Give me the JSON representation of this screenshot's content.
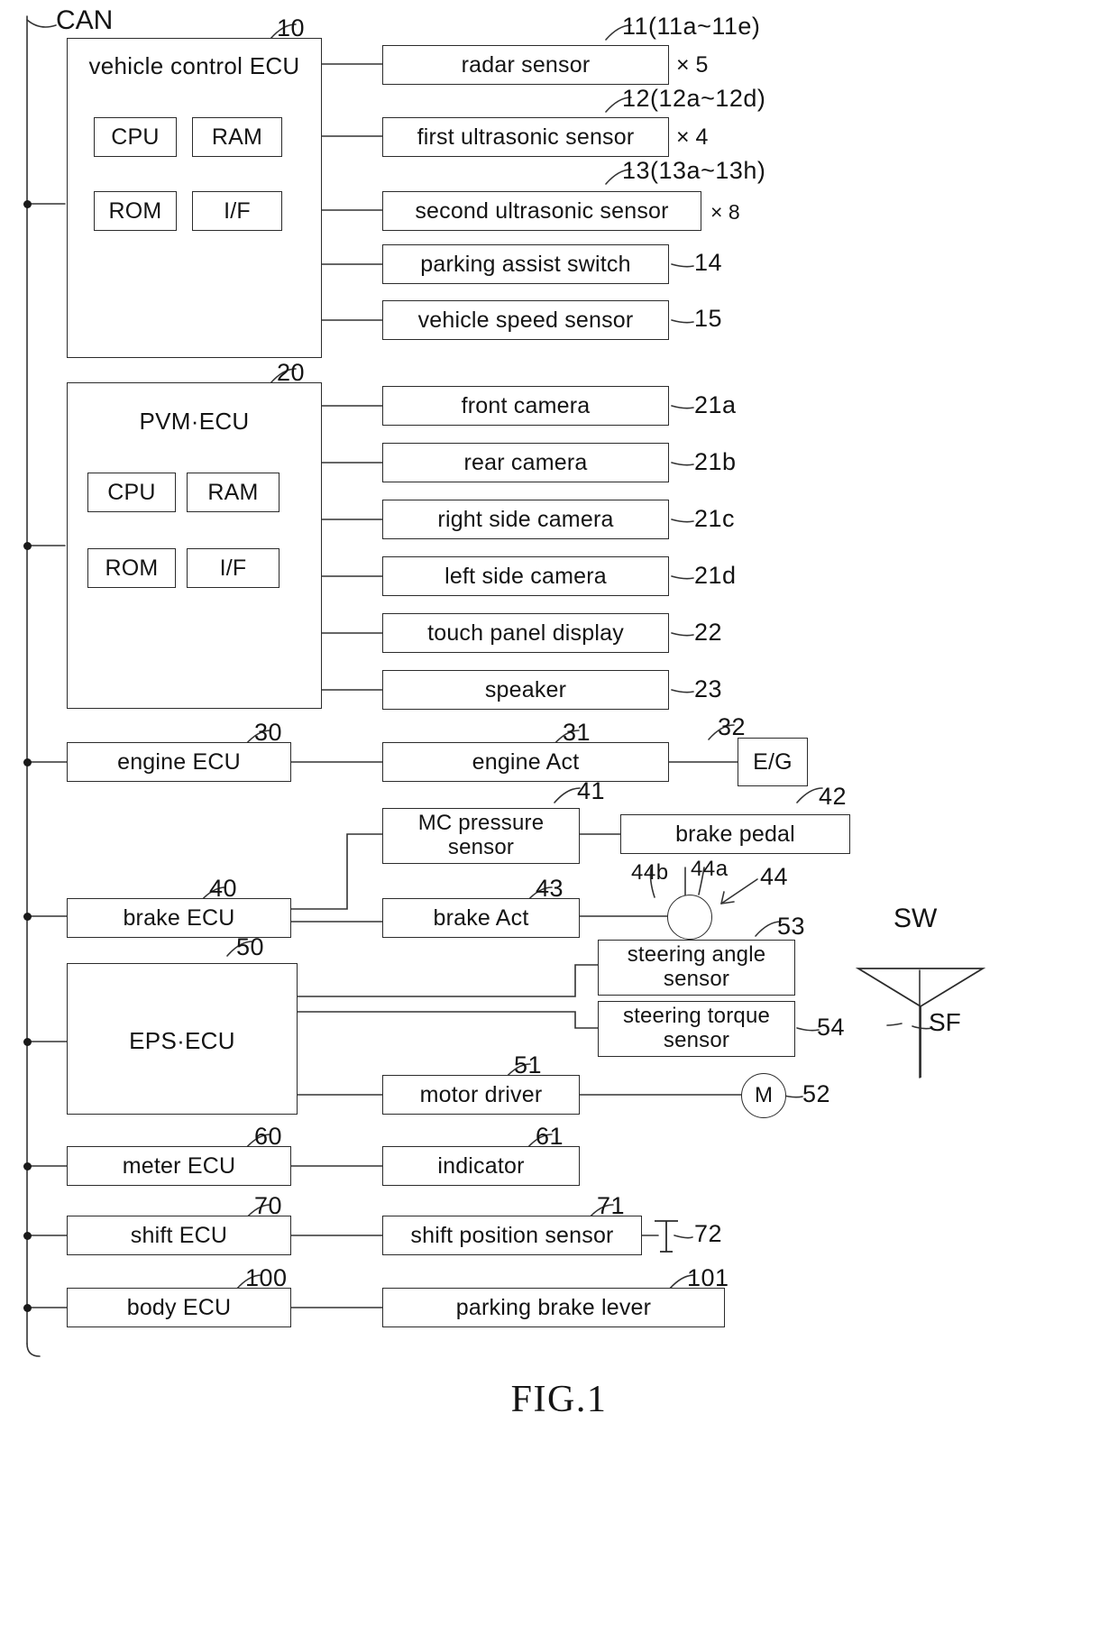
{
  "figure": {
    "caption": "FIG.1",
    "bus_label": "CAN"
  },
  "vehicle_control_ecu": {
    "ref": "10",
    "title": "vehicle control ECU",
    "modules": [
      {
        "label": "CPU"
      },
      {
        "label": "RAM"
      },
      {
        "label": "ROM"
      },
      {
        "label": "I/F"
      }
    ],
    "peripherals": [
      {
        "label": "radar sensor",
        "ref": "11(11a~11e)",
        "count": "× 5"
      },
      {
        "label": "first ultrasonic sensor",
        "ref": "12(12a~12d)",
        "count": "× 4"
      },
      {
        "label": "second ultrasonic sensor",
        "ref": "13(13a~13h)",
        "count": "× 8"
      },
      {
        "label": "parking assist switch",
        "ref": "14",
        "count": ""
      },
      {
        "label": "vehicle speed sensor",
        "ref": "15",
        "count": ""
      }
    ]
  },
  "pvm_ecu": {
    "ref": "20",
    "title": "PVM·ECU",
    "modules": [
      {
        "label": "CPU"
      },
      {
        "label": "RAM"
      },
      {
        "label": "ROM"
      },
      {
        "label": "I/F"
      }
    ],
    "peripherals": [
      {
        "label": "front camera",
        "ref": "21a"
      },
      {
        "label": "rear camera",
        "ref": "21b"
      },
      {
        "label": "right side camera",
        "ref": "21c"
      },
      {
        "label": "left side camera",
        "ref": "21d"
      },
      {
        "label": "touch panel display",
        "ref": "22"
      },
      {
        "label": "speaker",
        "ref": "23"
      }
    ]
  },
  "engine_group": {
    "ecu": {
      "label": "engine ECU",
      "ref": "30"
    },
    "actuator": {
      "label": "engine Act",
      "ref": "31"
    },
    "engine": {
      "label": "E/G",
      "ref": "32"
    }
  },
  "brake_group": {
    "ecu": {
      "label": "brake ECU",
      "ref": "40"
    },
    "mc_pressure_sensor": {
      "label": "MC pressure sensor",
      "ref": "41"
    },
    "brake_pedal": {
      "label": "brake pedal",
      "ref": "42"
    },
    "actuator": {
      "label": "brake Act",
      "ref": "43"
    },
    "joint": {
      "ref": "44",
      "ref_a": "44a",
      "ref_b": "44b"
    }
  },
  "eps_group": {
    "ecu": {
      "label": "EPS·ECU",
      "ref": "50"
    },
    "steering_angle_sensor": {
      "label": "steering angle sensor",
      "ref": "53"
    },
    "steering_torque_sensor": {
      "label": "steering torque sensor",
      "ref": "54"
    },
    "motor_driver": {
      "label": "motor driver",
      "ref": "51"
    },
    "motor": {
      "label": "M",
      "ref": "52"
    },
    "steering_wheel": {
      "label": "SW"
    },
    "steering_shaft": {
      "label": "SF"
    }
  },
  "meter_group": {
    "ecu": {
      "label": "meter ECU",
      "ref": "60"
    },
    "indicator": {
      "label": "indicator",
      "ref": "61"
    }
  },
  "shift_group": {
    "ecu": {
      "label": "shift ECU",
      "ref": "70"
    },
    "sensor": {
      "label": "shift position sensor",
      "ref": "71"
    },
    "lever": {
      "ref": "72"
    }
  },
  "body_group": {
    "ecu": {
      "label": "body ECU",
      "ref": "100"
    },
    "parking_brake_lever": {
      "label": "parking brake lever",
      "ref": "101"
    }
  }
}
